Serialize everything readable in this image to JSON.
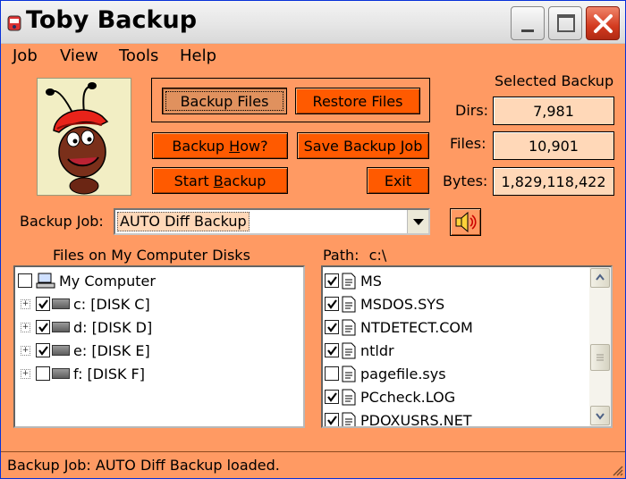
{
  "window": {
    "title": "Toby Backup"
  },
  "menu": {
    "items": [
      "Job",
      "View",
      "Tools",
      "Help"
    ]
  },
  "buttons": {
    "backup_files": "Backup Files",
    "restore_files": "Restore Files",
    "backup_how_pre": "Backup ",
    "backup_how_ul": "H",
    "backup_how_post": "ow?",
    "save_backup_job": "Save Backup Job",
    "start_backup_pre": "Start ",
    "start_backup_ul": "B",
    "start_backup_post": "ackup",
    "exit": "Exit"
  },
  "selected_backup": {
    "title": "Selected Backup",
    "dirs_label": "Dirs:",
    "dirs": "7,981",
    "files_label": "Files:",
    "files": "10,901",
    "bytes_label": "Bytes:",
    "bytes": "1,829,118,422"
  },
  "backup_job": {
    "label": "Backup Job:",
    "value": "AUTO Diff Backup"
  },
  "left_panel": {
    "title": "Files on My Computer Disks",
    "root": {
      "label": "My Computer",
      "checked": false
    },
    "drives": [
      {
        "label": "c: [DISK C]",
        "checked": true
      },
      {
        "label": "d: [DISK D]",
        "checked": true
      },
      {
        "label": "e: [DISK E]",
        "checked": true
      },
      {
        "label": "f: [DISK F]",
        "checked": false
      }
    ]
  },
  "right_panel": {
    "path_label": "Path:",
    "path_value": "c:\\",
    "files": [
      {
        "name": "MS",
        "checked": true
      },
      {
        "name": "MSDOS.SYS",
        "checked": true
      },
      {
        "name": "NTDETECT.COM",
        "checked": true
      },
      {
        "name": "ntldr",
        "checked": true
      },
      {
        "name": "pagefile.sys",
        "checked": false
      },
      {
        "name": "PCcheck.LOG",
        "checked": true
      },
      {
        "name": "PDOXUSRS.NET",
        "checked": true
      }
    ]
  },
  "status": {
    "text": "Backup Job: AUTO Diff Backup loaded."
  },
  "colors": {
    "window_bg": "#ff9a63",
    "button": "#ff5a00",
    "stat_box": "#ffd8b8"
  }
}
